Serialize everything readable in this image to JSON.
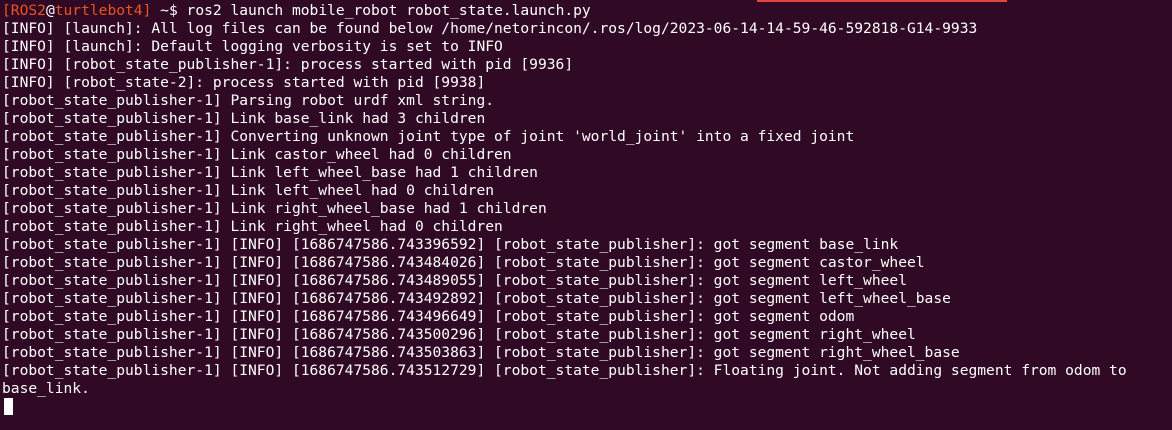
{
  "prompt": {
    "user": "[ROS2",
    "at": "@",
    "host": "turtlebot4]",
    "path": " ~$ ",
    "command": "ros2 launch mobile_robot robot_state.launch.py"
  },
  "output_lines": [
    "[INFO] [launch]: All log files can be found below /home/netorincon/.ros/log/2023-06-14-14-59-46-592818-G14-9933",
    "[INFO] [launch]: Default logging verbosity is set to INFO",
    "[INFO] [robot_state_publisher-1]: process started with pid [9936]",
    "[INFO] [robot_state-2]: process started with pid [9938]",
    "[robot_state_publisher-1] Parsing robot urdf xml string.",
    "[robot_state_publisher-1] Link base_link had 3 children",
    "[robot_state_publisher-1] Converting unknown joint type of joint 'world_joint' into a fixed joint",
    "[robot_state_publisher-1] Link castor_wheel had 0 children",
    "[robot_state_publisher-1] Link left_wheel_base had 1 children",
    "[robot_state_publisher-1] Link left_wheel had 0 children",
    "[robot_state_publisher-1] Link right_wheel_base had 1 children",
    "[robot_state_publisher-1] Link right_wheel had 0 children",
    "[robot_state_publisher-1] [INFO] [1686747586.743396592] [robot_state_publisher]: got segment base_link",
    "[robot_state_publisher-1] [INFO] [1686747586.743484026] [robot_state_publisher]: got segment castor_wheel",
    "[robot_state_publisher-1] [INFO] [1686747586.743489055] [robot_state_publisher]: got segment left_wheel",
    "[robot_state_publisher-1] [INFO] [1686747586.743492892] [robot_state_publisher]: got segment left_wheel_base",
    "[robot_state_publisher-1] [INFO] [1686747586.743496649] [robot_state_publisher]: got segment odom",
    "[robot_state_publisher-1] [INFO] [1686747586.743500296] [robot_state_publisher]: got segment right_wheel",
    "[robot_state_publisher-1] [INFO] [1686747586.743503863] [robot_state_publisher]: got segment right_wheel_base",
    "[robot_state_publisher-1] [INFO] [1686747586.743512729] [robot_state_publisher]: Floating joint. Not adding segment from odom to",
    "base_link."
  ],
  "colors": {
    "background": "#300a24",
    "text": "#ffffff",
    "prompt_accent": "#e95420"
  }
}
